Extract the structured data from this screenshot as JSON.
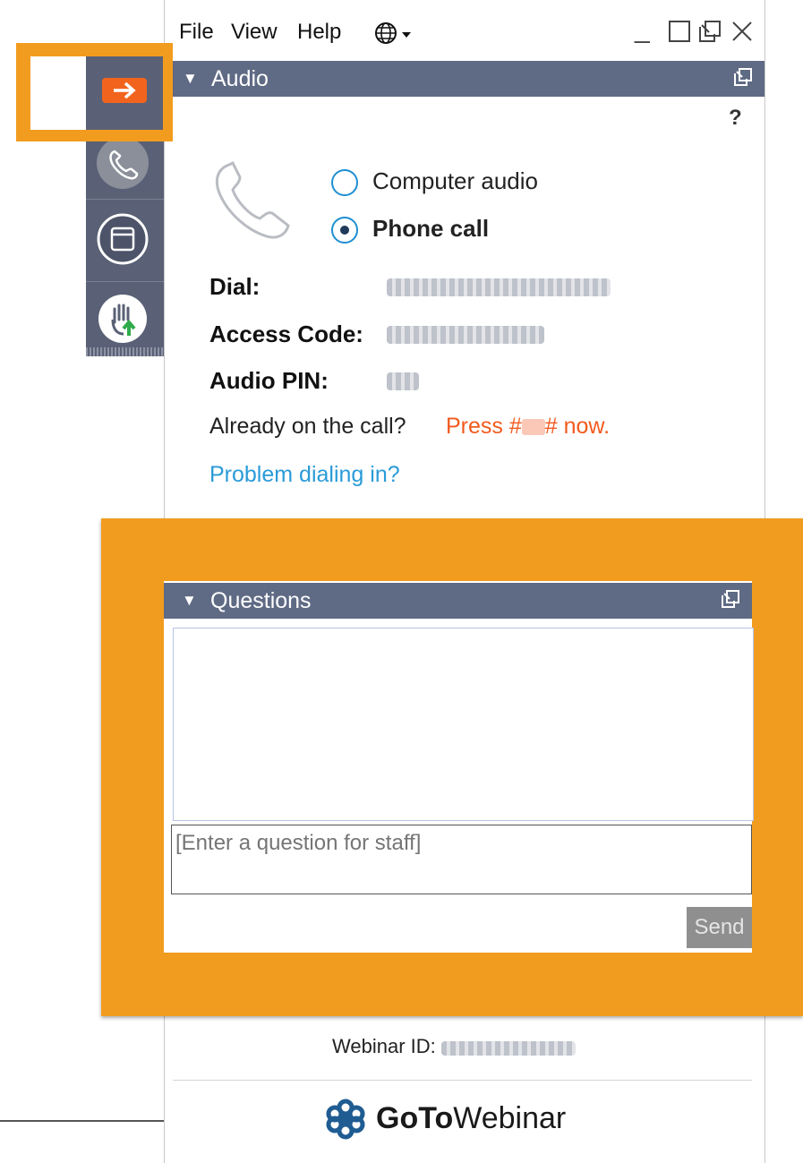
{
  "menu": {
    "file": "File",
    "view": "View",
    "help": "Help"
  },
  "window": {
    "minimize": "_",
    "maximize": "☐",
    "restore": "⧉",
    "close": "✕"
  },
  "audio": {
    "title": "Audio",
    "help_label": "?",
    "option_computer": "Computer audio",
    "option_phone": "Phone call",
    "selected": "Phone call",
    "dial_label": "Dial:",
    "access_code_label": "Access Code:",
    "audio_pin_label": "Audio PIN:",
    "already_text": "Already on the call?",
    "press_prefix": "Press #",
    "press_suffix": "# now.",
    "problem_link": "Problem dialing in?"
  },
  "questions": {
    "title": "Questions",
    "input_placeholder": "[Enter a question for staff]",
    "send_label": "Send"
  },
  "footer": {
    "webinar_id_label": "Webinar ID:",
    "brand_bold": "GoTo",
    "brand_rest": "Webinar"
  },
  "colors": {
    "header_bg": "#5f6a84",
    "highlight": "#f29c1f",
    "accent_orange": "#f25a1e",
    "link_blue": "#2a9bd8"
  },
  "icons": [
    "globe-icon",
    "phone-icon",
    "arrow-right-icon",
    "window-icon",
    "raise-hand-icon",
    "popout-icon",
    "gotowebinar-logo-icon"
  ]
}
